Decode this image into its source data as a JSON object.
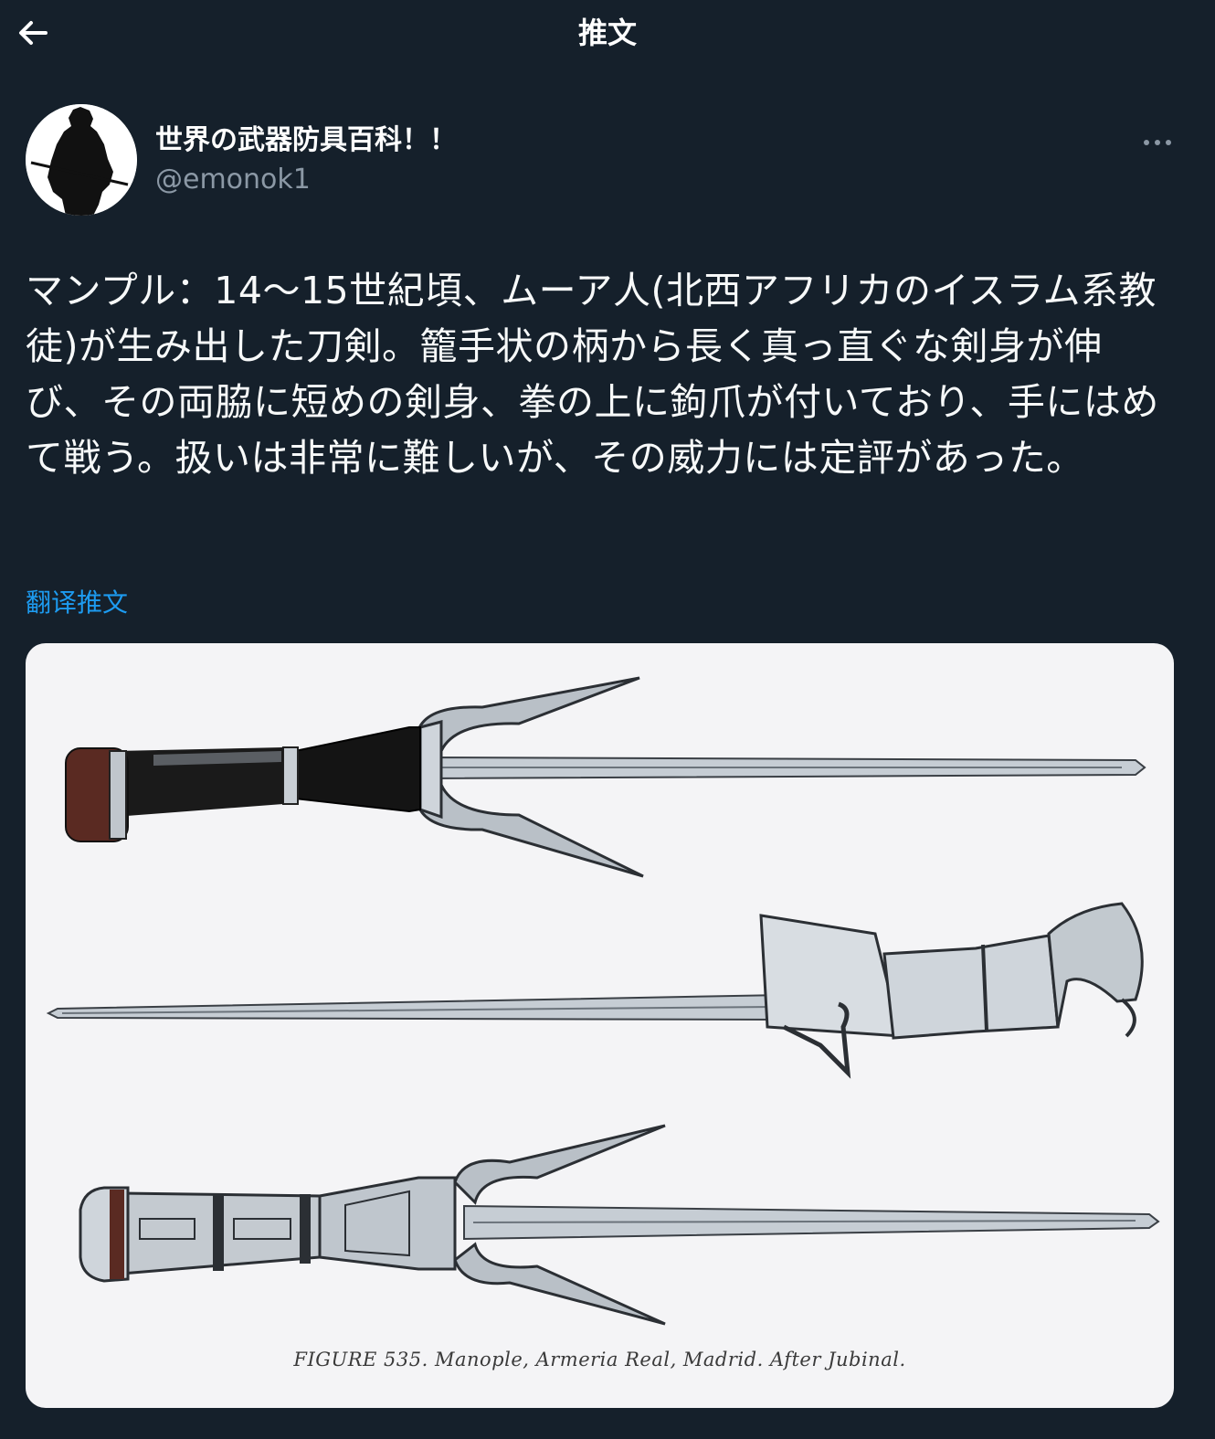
{
  "header": {
    "title": "推文"
  },
  "author": {
    "display_name": "世界の武器防具百科！！",
    "handle": "@emonok1"
  },
  "tweet": {
    "text": "マンプル：14〜15世紀頃、ムーア人(北西アフリカのイスラム系教徒)が生み出した刀剣。籠手状の柄から長く真っ直ぐな剣身が伸び、その両脇に短めの剣身、拳の上に鉤爪が付いており、手にはめて戦う。扱いは非常に難しいが、その威力には定評があった。"
  },
  "translate": {
    "label": "翻译推文"
  },
  "media": {
    "caption": "FIGURE 535. Manople, Armeria Real, Madrid. After Jubinal."
  },
  "icons": {
    "back": "arrow-left-icon",
    "more": "more-horizontal-icon"
  },
  "colors": {
    "background": "#15202b",
    "link": "#1d9bf0",
    "secondary_text": "#8b98a5"
  }
}
